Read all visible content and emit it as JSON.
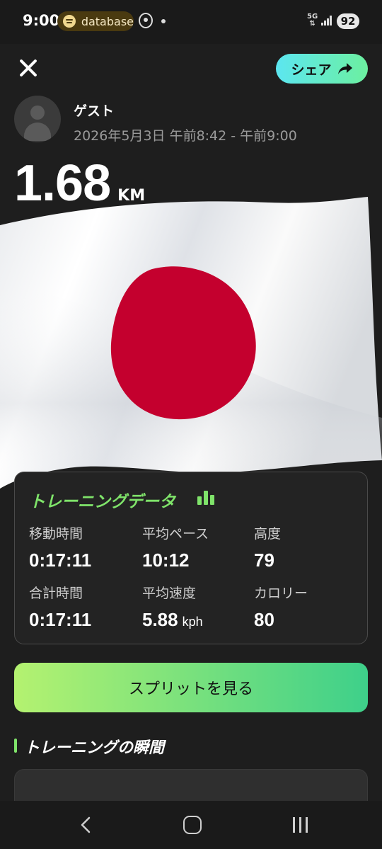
{
  "status_bar": {
    "time": "9:00",
    "media_app": "database",
    "network": "5G",
    "battery": "92"
  },
  "header": {
    "close_icon": "close-icon",
    "share_label": "シェア",
    "share_icon": "share-arrow-icon"
  },
  "user": {
    "name": "ゲスト",
    "date_range": "2026年5月3日 午前8:42 - 午前9:00"
  },
  "distance": {
    "value": "1.68",
    "unit": "KM"
  },
  "training": {
    "title": "トレーニングデータ",
    "stats": [
      {
        "label": "移動時間",
        "value": "0:17:11",
        "unit": ""
      },
      {
        "label": "平均ペース",
        "value": "10:12",
        "unit": ""
      },
      {
        "label": "高度",
        "value": "79",
        "unit": ""
      },
      {
        "label": "合計時間",
        "value": "0:17:11",
        "unit": ""
      },
      {
        "label": "平均速度",
        "value": "5.88",
        "unit": "kph"
      },
      {
        "label": "カロリー",
        "value": "80",
        "unit": ""
      }
    ]
  },
  "splits_button": "スプリットを見る",
  "moments": {
    "title": "トレーニングの瞬間"
  },
  "colors": {
    "background": "#1e1e1e",
    "accent_green": "#7fe36a",
    "flag_red": "#c4002e",
    "share_gradient_start": "#5ce6f0",
    "share_gradient_end": "#6cf0a0"
  }
}
